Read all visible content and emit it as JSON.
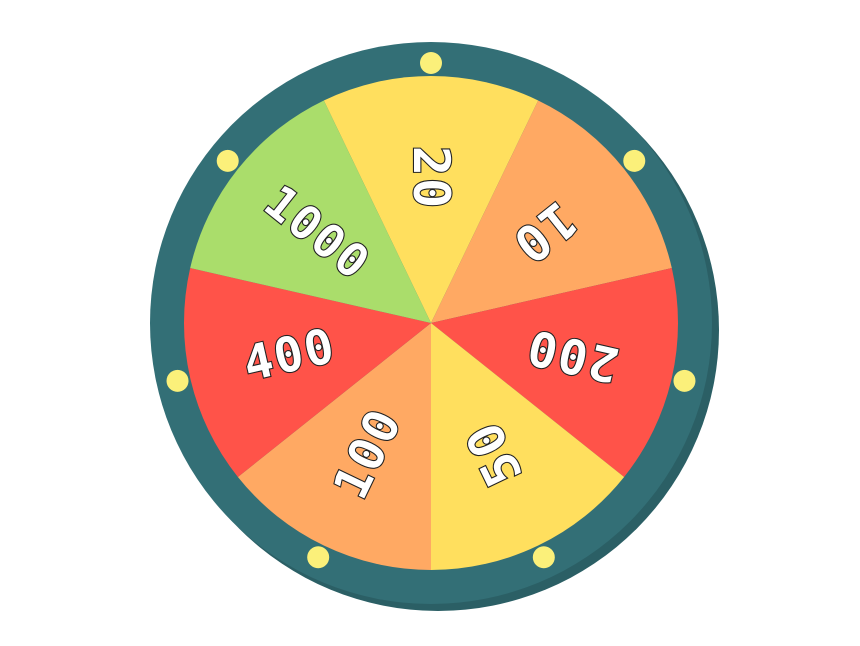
{
  "wheel": {
    "rim_color": "#336f76",
    "rim_shadow_color": "#2b5f65",
    "peg_color": "#fbf07a",
    "peg_count": 7,
    "segments": [
      {
        "label": "20",
        "color": "#ffdf5e"
      },
      {
        "label": "10",
        "color": "#ffa963"
      },
      {
        "label": "200",
        "color": "#ff5349"
      },
      {
        "label": "50",
        "color": "#ffdf5e"
      },
      {
        "label": "100",
        "color": "#ffa963"
      },
      {
        "label": "400",
        "color": "#ff5349"
      },
      {
        "label": "1000",
        "color": "#aadd6b"
      }
    ]
  }
}
